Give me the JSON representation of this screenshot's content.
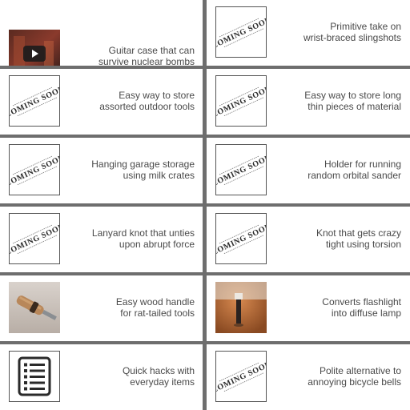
{
  "tiles": [
    {
      "caption_line1": "Guitar case that can",
      "caption_line2": "survive nuclear bombs",
      "thumb": "video",
      "play_icon": "play-icon"
    },
    {
      "caption_line1": "Primitive take on",
      "caption_line2": "wrist-braced slingshots",
      "thumb": "coming-soon",
      "stamp": "COMING SOON"
    },
    {
      "caption_line1": "Easy way to store",
      "caption_line2": "assorted outdoor tools",
      "thumb": "coming-soon",
      "stamp": "COMING SOON"
    },
    {
      "caption_line1": "Easy way to store long",
      "caption_line2": "thin pieces of material",
      "thumb": "coming-soon",
      "stamp": "COMING SOON"
    },
    {
      "caption_line1": "Hanging garage storage",
      "caption_line2": "using milk crates",
      "thumb": "coming-soon",
      "stamp": "COMING SOON"
    },
    {
      "caption_line1": "Holder for running",
      "caption_line2": "random orbital sander",
      "thumb": "coming-soon",
      "stamp": "COMING SOON"
    },
    {
      "caption_line1": "Lanyard knot that unties",
      "caption_line2": "upon abrupt force",
      "thumb": "coming-soon",
      "stamp": "COMING SOON"
    },
    {
      "caption_line1": "Knot that gets crazy",
      "caption_line2": "tight using torsion",
      "thumb": "coming-soon",
      "stamp": "COMING SOON"
    },
    {
      "caption_line1": "Easy wood handle",
      "caption_line2": "for rat-tailed tools",
      "thumb": "photo-handle"
    },
    {
      "caption_line1": "Converts flashlight",
      "caption_line2": "into diffuse lamp",
      "thumb": "photo-lamp"
    },
    {
      "caption_line1": "Quick hacks with",
      "caption_line2": "everyday items",
      "thumb": "list",
      "icon": "list-icon"
    },
    {
      "caption_line1": "Polite alternative to",
      "caption_line2": "annoying bicycle bells",
      "thumb": "coming-soon",
      "stamp": "COMING SOON"
    }
  ],
  "colors": {
    "divider": "#6e6e6e",
    "caption": "#4a4a4a",
    "background": "#ffffff"
  }
}
